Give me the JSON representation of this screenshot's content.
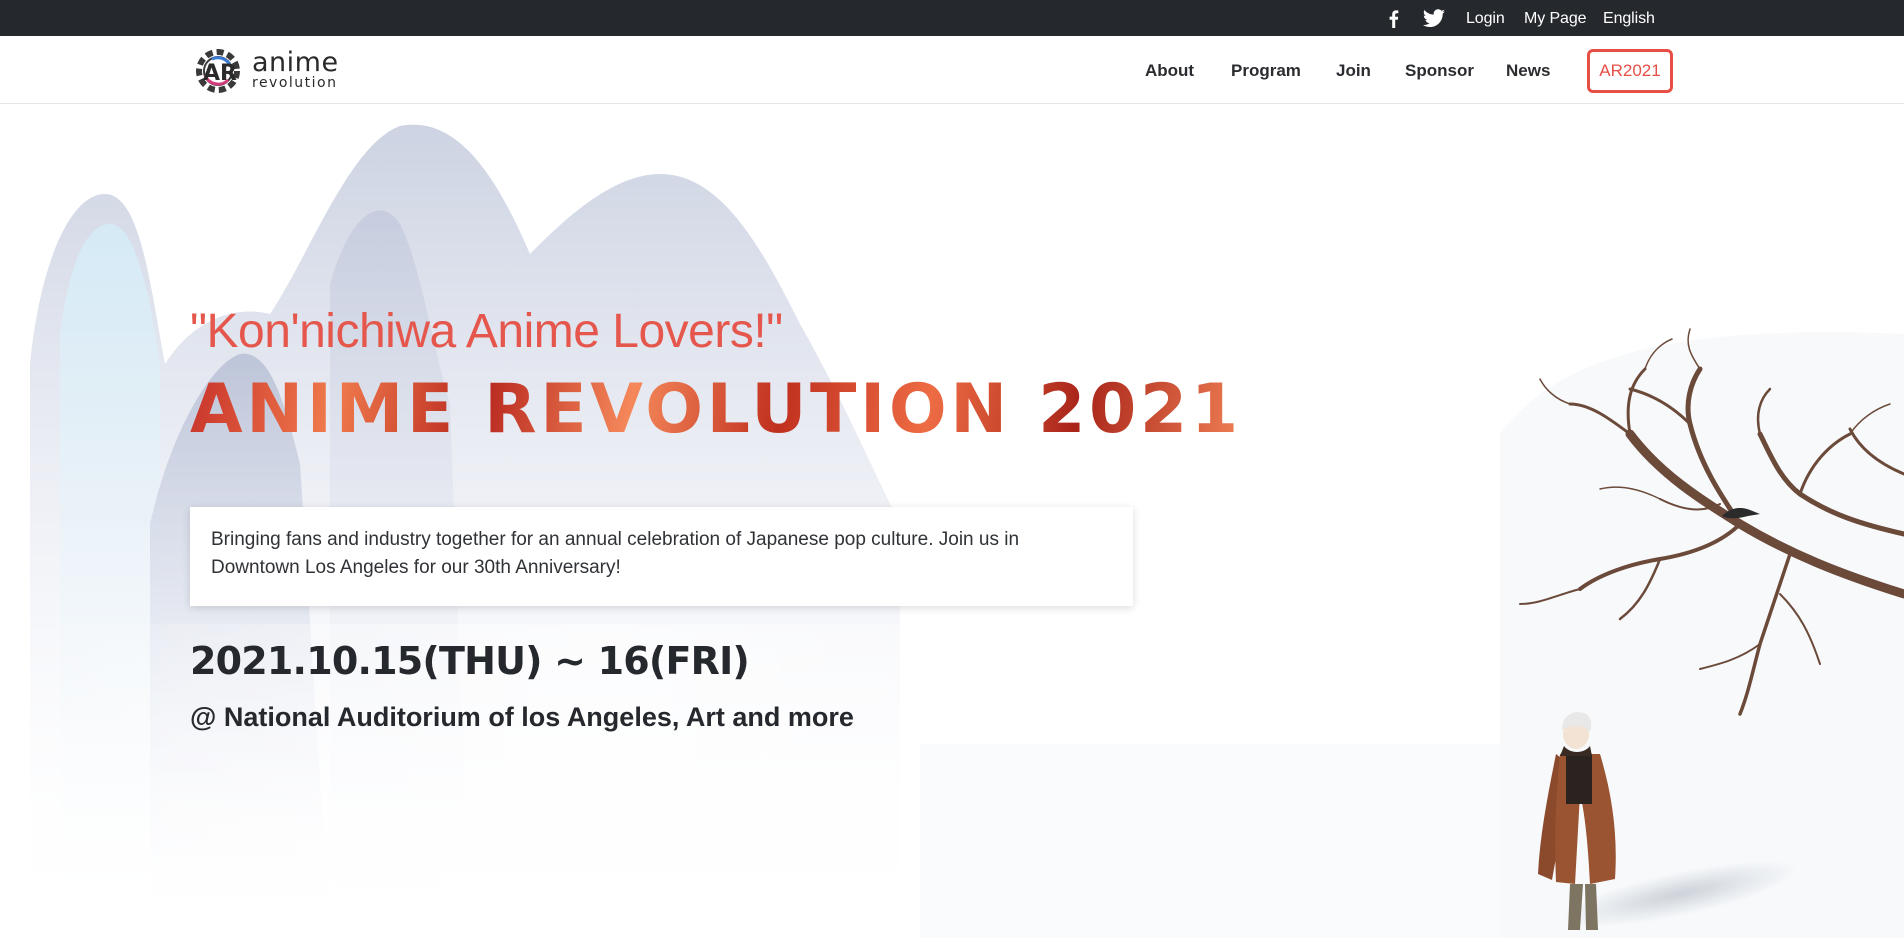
{
  "topbar": {
    "facebook_icon": "facebook-icon",
    "twitter_icon": "twitter-icon",
    "login": "Login",
    "my_page": "My Page",
    "language": "English"
  },
  "nav": {
    "logo_word1": "anime",
    "logo_word2": "revolution",
    "logo_mark": "AR",
    "items": [
      {
        "label": "About"
      },
      {
        "label": "Program"
      },
      {
        "label": "Join"
      },
      {
        "label": "Sponsor"
      },
      {
        "label": "News"
      }
    ],
    "highlight_button": "AR2021"
  },
  "hero": {
    "greeting": "\"Kon'nichiwa Anime Lovers!\"",
    "headline": "ANIME REVOLUTION 2021",
    "description": "Bringing fans and industry together for an annual celebration of Japanese pop culture. Join us in Downtown Los Angeles for our 30th Anniversary!",
    "dates": "2021.10.15(THU) ~ 16(FRI)",
    "venue": "@ National Auditorium of los Angeles, Art and more"
  },
  "colors": {
    "topbar_bg": "#25282d",
    "accent": "#e54f45",
    "text_dark": "#25282d"
  }
}
